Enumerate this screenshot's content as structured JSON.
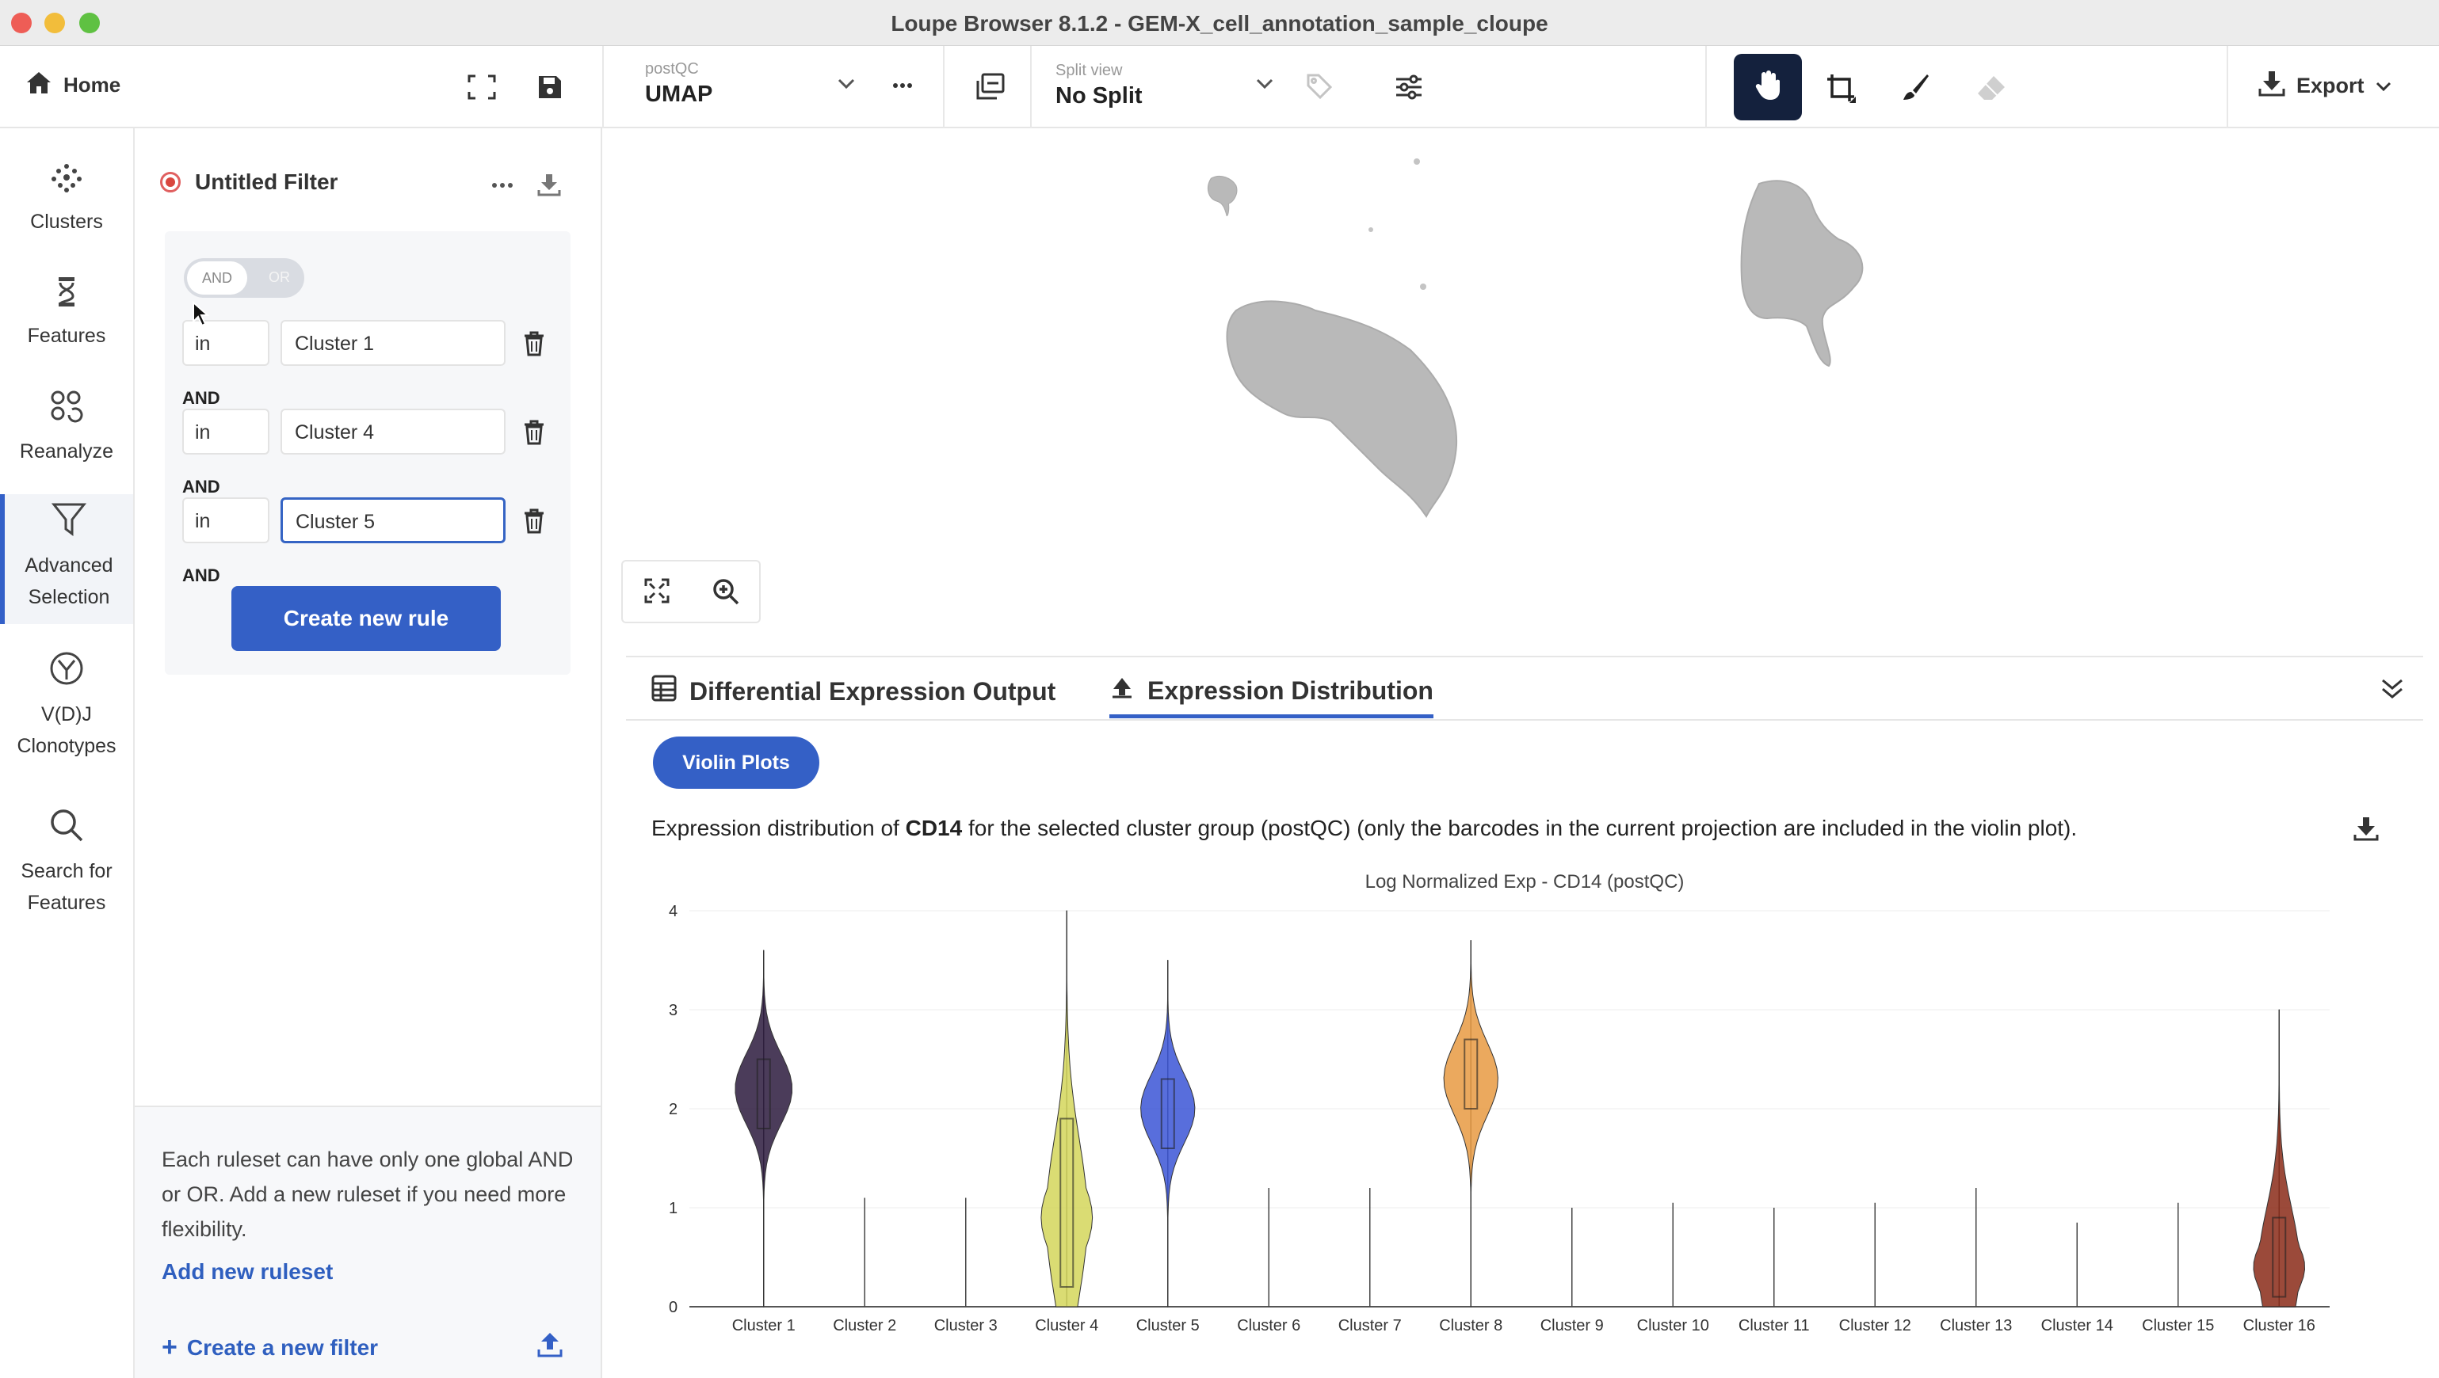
{
  "window": {
    "title": "Loupe Browser 8.1.2 - GEM-X_cell_annotation_sample_cloupe"
  },
  "toolbar": {
    "home_label": "Home",
    "projection": {
      "label": "postQC",
      "value": "UMAP"
    },
    "split_view": {
      "label": "Split view",
      "value": "No Split"
    },
    "export_label": "Export"
  },
  "nav": {
    "items": [
      {
        "label": "Clusters",
        "icon": "clusters-icon"
      },
      {
        "label": "Features",
        "icon": "features-icon"
      },
      {
        "label": "Reanalyze",
        "icon": "reanalyze-icon"
      },
      {
        "label": "Advanced Selection",
        "icon": "filter-icon",
        "active": true
      },
      {
        "label": "V(D)J Clonotypes",
        "icon": "vdj-icon"
      },
      {
        "label": "Search for Features",
        "icon": "search-icon"
      }
    ]
  },
  "filter": {
    "title": "Untitled Filter",
    "toggle": {
      "on": "AND",
      "off": "OR"
    },
    "rules": [
      {
        "op": "in",
        "value": "Cluster 1"
      },
      {
        "op": "in",
        "value": "Cluster 4"
      },
      {
        "op": "in",
        "value": "Cluster 5"
      }
    ],
    "joiner": "AND",
    "create_rule_label": "Create new rule",
    "help_text": "Each ruleset can have only one global AND or OR. Add a new ruleset if you need more flexibility.",
    "add_ruleset_label": "Add new ruleset",
    "create_filter_label": "Create a new filter"
  },
  "bottom": {
    "tabs": [
      {
        "label": "Differential Expression Output",
        "icon": "table-icon"
      },
      {
        "label": "Expression Distribution",
        "icon": "distribution-icon",
        "active": true
      }
    ],
    "pill_label": "Violin Plots",
    "desc_prefix": "Expression distribution of ",
    "desc_gene": "CD14",
    "desc_suffix": " for the selected cluster group (postQC) (only the barcodes in the current projection are included in the violin plot)."
  },
  "chart_data": {
    "type": "violin",
    "title": "Log Normalized Exp - CD14 (postQC)",
    "ylim": [
      0,
      4
    ],
    "yticks": [
      0,
      1,
      2,
      3,
      4
    ],
    "grid": true,
    "categories": [
      "Cluster 1",
      "Cluster 2",
      "Cluster 3",
      "Cluster 4",
      "Cluster 5",
      "Cluster 6",
      "Cluster 7",
      "Cluster 8",
      "Cluster 9",
      "Cluster 10",
      "Cluster 11",
      "Cluster 12",
      "Cluster 13",
      "Cluster 14",
      "Cluster 15",
      "Cluster 16"
    ],
    "max": [
      3.6,
      1.1,
      1.1,
      4.0,
      3.5,
      1.2,
      1.2,
      3.7,
      1.0,
      1.05,
      1.0,
      1.05,
      1.2,
      0.85,
      1.05,
      3.0
    ],
    "center": [
      2.2,
      null,
      null,
      0.9,
      2.0,
      null,
      null,
      2.3,
      null,
      null,
      null,
      null,
      null,
      null,
      null,
      0.4
    ],
    "widthScale": [
      1,
      0,
      0,
      0.9,
      0.95,
      0,
      0,
      0.95,
      0,
      0,
      0,
      0,
      0,
      0,
      0,
      0.9
    ],
    "colors": [
      "#2b1a3d",
      "#3d2a4a",
      "#3d2a4a",
      "#d4d65a",
      "#3b55d6",
      "#444444",
      "#444444",
      "#e89a42",
      "#444444",
      "#444444",
      "#444444",
      "#444444",
      "#444444",
      "#444444",
      "#444444",
      "#8a2a18"
    ],
    "box_q1": [
      1.8,
      null,
      null,
      0.2,
      1.6,
      null,
      null,
      2.0,
      null,
      null,
      null,
      null,
      null,
      null,
      null,
      0.1
    ],
    "box_q3": [
      2.5,
      null,
      null,
      1.9,
      2.3,
      null,
      null,
      2.7,
      null,
      null,
      null,
      null,
      null,
      null,
      null,
      0.9
    ]
  }
}
